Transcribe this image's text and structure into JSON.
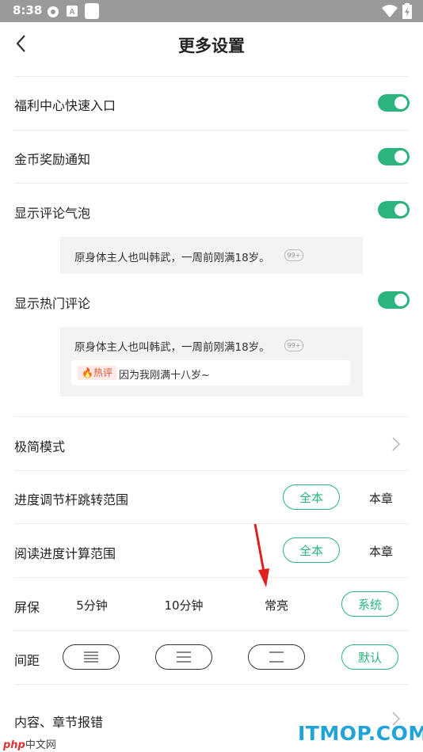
{
  "status": {
    "time": "8:38",
    "icons": [
      "settings-gear-icon",
      "a-square-icon",
      "blank-square-icon",
      "wifi-icon",
      "battery-icon"
    ]
  },
  "header": {
    "title": "更多设置",
    "back_icon": "chevron-left-icon"
  },
  "toggles": [
    {
      "label": "福利中心快速入口",
      "on": true
    },
    {
      "label": "金币奖励通知",
      "on": true
    },
    {
      "label": "显示评论气泡",
      "on": true
    },
    {
      "label": "显示热门评论",
      "on": true
    }
  ],
  "preview1": {
    "text": "原身体主人也叫韩武，一周前刚满18岁。",
    "badge": "99+"
  },
  "preview2": {
    "text": "原身体主人也叫韩武，一周前刚满18岁。",
    "badge": "99+",
    "hot_tag": "热评",
    "hot_text": "因为我刚满十八岁~"
  },
  "simple_mode": {
    "label": "极简模式"
  },
  "progress_range": {
    "label": "进度调节杆跳转范围",
    "options": [
      "全本",
      "本章"
    ],
    "selected": "全本"
  },
  "reading_range": {
    "label": "阅读进度计算范围",
    "options": [
      "全本",
      "本章"
    ],
    "selected": "全本"
  },
  "screensaver": {
    "label": "屏保",
    "options": [
      "5分钟",
      "10分钟",
      "常亮",
      "系统"
    ],
    "selected": "系统"
  },
  "spacing": {
    "label": "间距",
    "default_label": "默认",
    "selected": "默认"
  },
  "report": {
    "label": "内容、章节报错"
  },
  "colors": {
    "accent": "#2bb47d",
    "hot": "#e8533a",
    "annotation_arrow": "#e02020"
  },
  "watermark": {
    "site": "ITMOP.COM",
    "php_logo": "php",
    "php_text": "中文网"
  }
}
